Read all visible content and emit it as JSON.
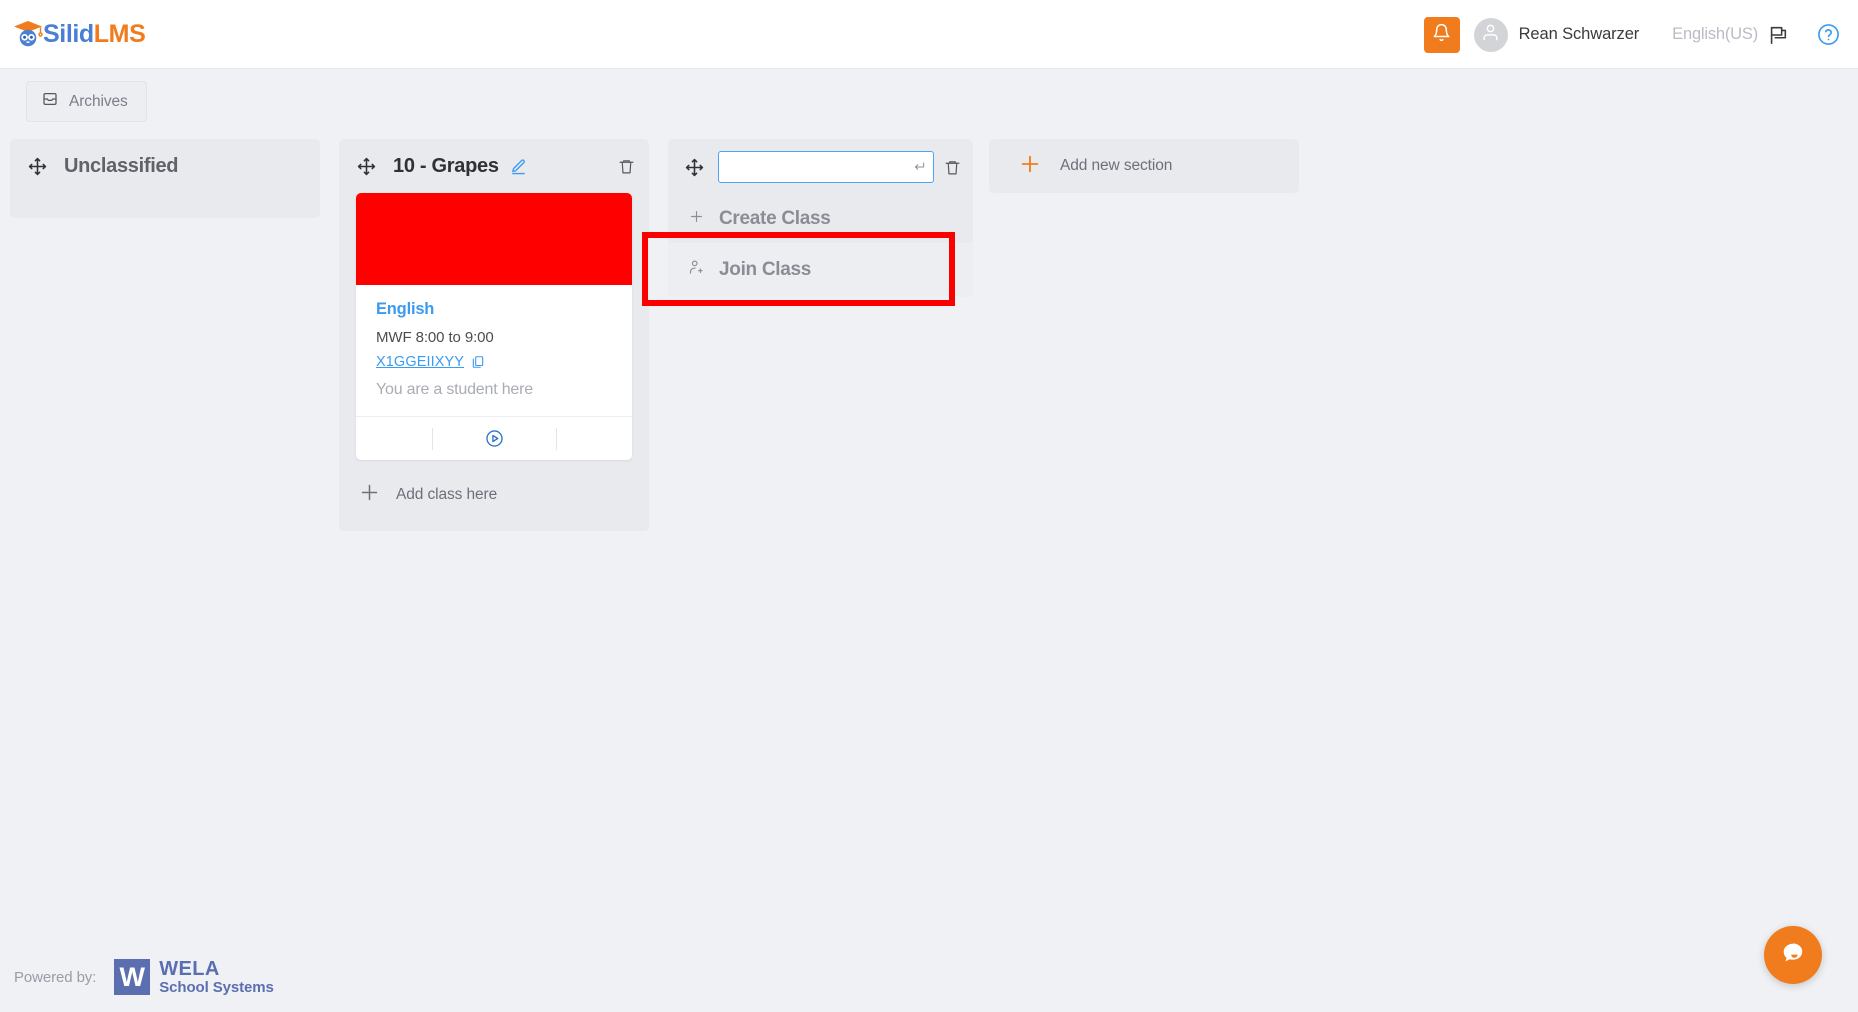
{
  "header": {
    "logo": {
      "part1": "Silid",
      "part2": "LMS",
      "icon": "graduation-owl-icon"
    },
    "notifications_icon": "bell-icon",
    "avatar_icon": "user-avatar-icon",
    "user_name": "Rean Schwarzer",
    "language": "English(US)",
    "flag_icon": "flag-icon",
    "help_icon": "question-circle-icon",
    "accent_orange": "#f07c1e"
  },
  "toolbar": {
    "archives_label": "Archives",
    "archives_icon": "archive-box-icon"
  },
  "board": {
    "sections": [
      {
        "id": "unclassified",
        "title": "Unclassified",
        "move_icon": "move-arrows-icon",
        "classes": []
      },
      {
        "id": "grapes",
        "title": "10 - Grapes",
        "move_icon": "move-arrows-icon",
        "edit_icon": "pencil-icon",
        "delete_icon": "trash-icon",
        "add_class_label": "Add class here",
        "add_class_icon": "plus-icon",
        "classes": [
          {
            "banner_color": "#fe0000",
            "title": "English",
            "schedule": "MWF 8:00 to 9:00",
            "code": "X1GGEIIXYY",
            "copy_icon": "copy-icon",
            "role": "You are a student here",
            "action_icon": "play-circle-icon"
          }
        ]
      },
      {
        "id": "new-section",
        "move_icon": "move-arrows-icon",
        "input_value": "",
        "input_placeholder": "",
        "enter_icon": "enter-return-icon",
        "delete_icon": "trash-icon",
        "menu": [
          {
            "label": "Create Class",
            "icon": "plus-icon",
            "highlighted": false
          },
          {
            "label": "Join Class",
            "icon": "person-add-icon",
            "highlighted": true
          }
        ]
      }
    ],
    "add_section": {
      "label": "Add new section",
      "icon": "plus-icon",
      "icon_color": "#f07c1e"
    }
  },
  "annotation": {
    "color": "#fb0000",
    "target": "Join Class"
  },
  "footer": {
    "powered_by_label": "Powered by:",
    "brand_mark": "W",
    "brand_line1": "WELA",
    "brand_line2": "School Systems"
  },
  "chat_widget": {
    "icon": "chat-bubble-icon",
    "color": "#f07c1e"
  }
}
